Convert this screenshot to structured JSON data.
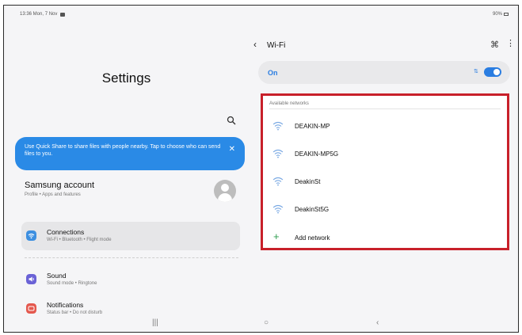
{
  "status_bar": {
    "time_date": "13:36 Mon, 7 Nov",
    "battery": "90%"
  },
  "left": {
    "title": "Settings",
    "banner": {
      "text": "Use Quick Share to share files with people nearby. Tap to choose who can send files to you.",
      "close": "✕"
    },
    "account": {
      "title": "Samsung account",
      "subtitle": "Profile • Apps and features"
    },
    "items": [
      {
        "title": "Connections",
        "subtitle": "Wi-Fi • Bluetooth • Flight mode",
        "icon": "wifi-icon",
        "color": "#3d8fe0"
      },
      {
        "title": "Sound",
        "subtitle": "Sound mode • Ringtone",
        "icon": "speaker-icon",
        "color": "#6a62d6"
      },
      {
        "title": "Notifications",
        "subtitle": "Status bar • Do not disturb",
        "icon": "bell-icon",
        "color": "#e4584e"
      }
    ]
  },
  "right": {
    "back": "‹",
    "title": "Wi-Fi",
    "wifi_state": "On",
    "available_header": "Available networks",
    "networks": [
      "DEAKIN-MP",
      "DEAKIN-MP5G",
      "DeakinSt",
      "DeakinSt5G"
    ],
    "add_icon": "+",
    "add_label": "Add network"
  },
  "nav": {
    "recents": "|||",
    "home": "○",
    "back": "‹"
  },
  "colors": {
    "accent": "#2a7de1",
    "highlight_border": "#c8202a",
    "banner": "#2a8ae6",
    "add": "#2e9d4e"
  }
}
